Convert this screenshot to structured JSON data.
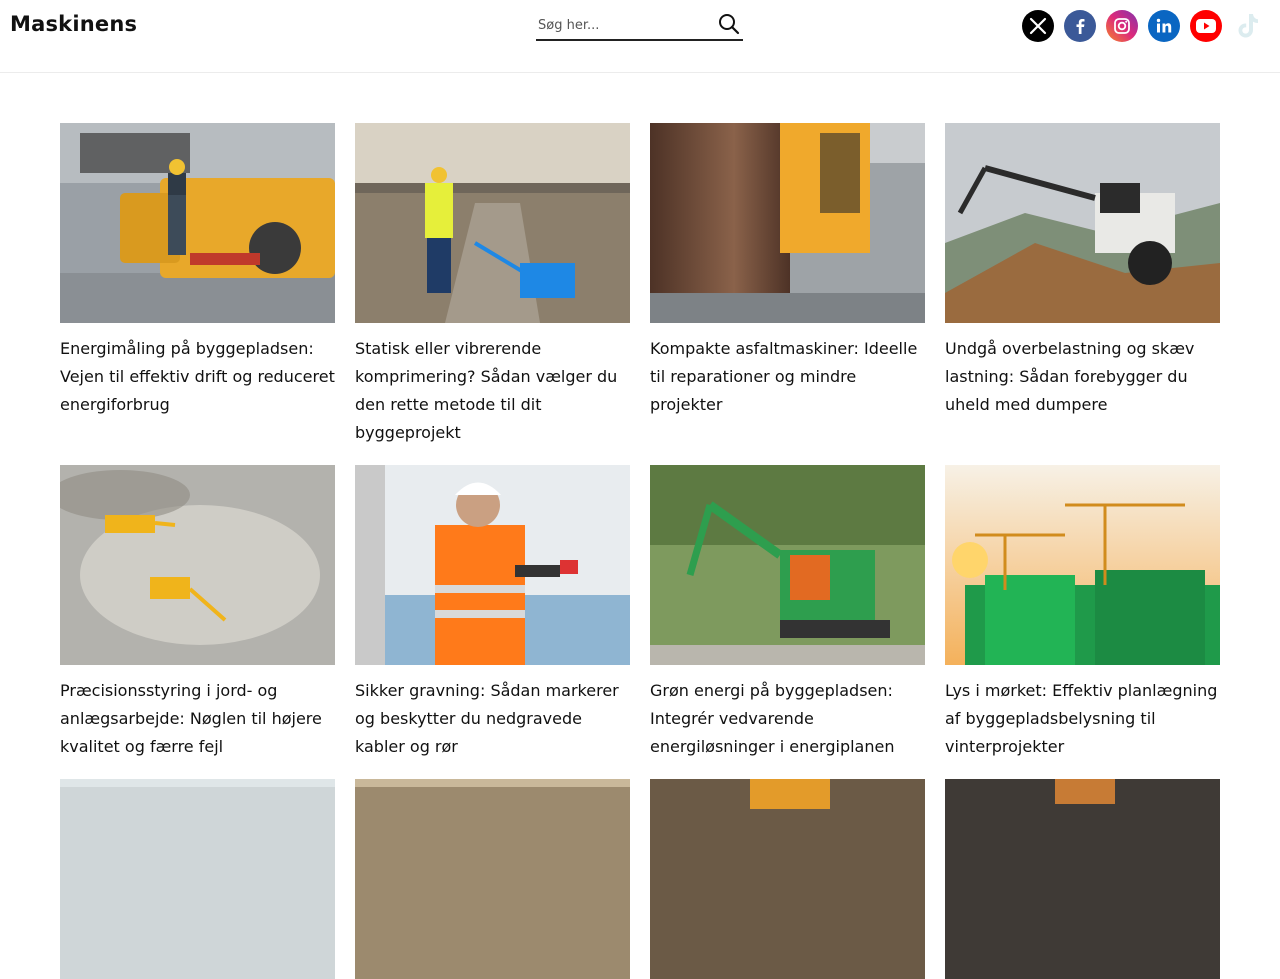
{
  "header": {
    "logo": "Maskinens",
    "search_placeholder": "Søg her...",
    "socials": [
      "x-icon",
      "facebook-icon",
      "instagram-icon",
      "linkedin-icon",
      "youtube-icon",
      "tiktok-icon"
    ]
  },
  "articles": [
    {
      "title": "Energimåling på byggepladsen: Vejen til effektiv drift og reduceret energiforbrug"
    },
    {
      "title": "Statisk eller vibrerende komprimering? Sådan vælger du den rette metode til dit byggeprojekt"
    },
    {
      "title": "Kompakte asfaltmaskiner: Ideelle til reparationer og mindre projekter"
    },
    {
      "title": "Undgå overbelastning og skæv lastning: Sådan forebygger du uheld med dumpere"
    },
    {
      "title": "Præcisionsstyring i jord- og anlægsarbejde: Nøglen til højere kvalitet og færre fejl"
    },
    {
      "title": "Sikker gravning: Sådan markerer og beskytter du nedgravede kabler og rør"
    },
    {
      "title": "Grøn energi på byggepladsen: Integrér vedvarende energiløsninger i energiplanen"
    },
    {
      "title": "Lys i mørket: Effektiv planlægning af byggepladsbelysning til vinterprojekter"
    }
  ]
}
